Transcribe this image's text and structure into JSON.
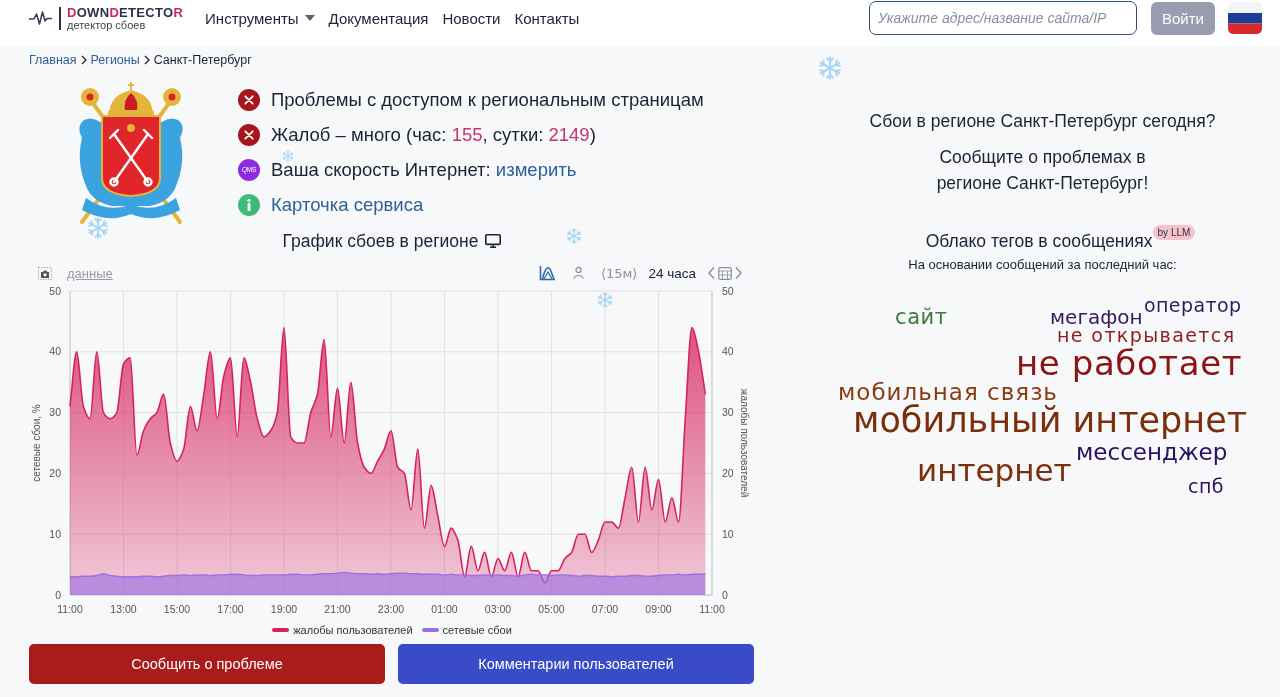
{
  "header": {
    "logo": {
      "segments": [
        {
          "text": "D",
          "accent": true
        },
        {
          "text": "OWN",
          "accent": false
        },
        {
          "text": "D",
          "accent": true
        },
        {
          "text": "ETECTO",
          "accent": false
        },
        {
          "text": "R",
          "accent": true
        }
      ],
      "tagline": "детектор сбоев"
    },
    "nav": [
      {
        "label": "Инструменты",
        "dropdown": true
      },
      {
        "label": "Документация",
        "dropdown": false
      },
      {
        "label": "Новости",
        "dropdown": false
      },
      {
        "label": "Контакты",
        "dropdown": false
      }
    ],
    "search": {
      "placeholder": "Укажите адрес/название сайта/IP"
    },
    "login_button": "Войти"
  },
  "breadcrumbs": [
    {
      "label": "Главная",
      "current": false
    },
    {
      "label": "Регионы",
      "current": false
    },
    {
      "label": "Санкт-Петербург",
      "current": true
    }
  ],
  "status": [
    {
      "kind": "error",
      "parts": [
        {
          "kind": "text",
          "text": "Проблемы с доступом к региональным страницам"
        }
      ]
    },
    {
      "kind": "error",
      "parts": [
        {
          "kind": "text",
          "text": "Жалоб – много (час: "
        },
        {
          "kind": "count",
          "text": "155"
        },
        {
          "kind": "text",
          "text": ", сутки: "
        },
        {
          "kind": "count",
          "text": "2149"
        },
        {
          "kind": "text",
          "text": ")"
        }
      ]
    },
    {
      "kind": "speed",
      "badge": "QMS",
      "parts": [
        {
          "kind": "text",
          "text": "Ваша скорость Интернет: "
        },
        {
          "kind": "link",
          "text": "измерить"
        }
      ]
    },
    {
      "kind": "info",
      "parts": [
        {
          "kind": "link",
          "text": "Карточка сервиса"
        }
      ]
    }
  ],
  "chart": {
    "data_link": "данные",
    "view_modes": [
      {
        "kind": "area",
        "selected": true
      },
      {
        "kind": "users",
        "selected": false
      }
    ],
    "periods": [
      {
        "label": "⟨15м⟩",
        "selected": false
      },
      {
        "label": "24 часа",
        "selected": true
      }
    ],
    "chart_data": {
      "type": "area",
      "title": "График сбоев в регионе",
      "ylabel": "сетевые сбои, %",
      "y2label": "жалобы пользователей",
      "grid": true,
      "legend": "bottom",
      "categories": [
        "11:00",
        null,
        null,
        null,
        null,
        null,
        null,
        null,
        "13:00",
        null,
        null,
        null,
        null,
        null,
        null,
        null,
        "15:00",
        null,
        null,
        null,
        null,
        null,
        null,
        null,
        "17:00",
        null,
        null,
        null,
        null,
        null,
        null,
        null,
        "19:00",
        null,
        null,
        null,
        null,
        null,
        null,
        null,
        "21:00",
        null,
        null,
        null,
        null,
        null,
        null,
        null,
        "23:00",
        null,
        null,
        null,
        null,
        null,
        null,
        null,
        "01:00",
        null,
        null,
        null,
        null,
        null,
        null,
        null,
        "03:00",
        null,
        null,
        null,
        null,
        null,
        null,
        null,
        "05:00",
        null,
        null,
        null,
        null,
        null,
        null,
        null,
        "07:00",
        null,
        null,
        null,
        null,
        null,
        null,
        null,
        "09:00",
        null,
        null,
        null,
        null,
        null,
        null,
        null,
        "11:00"
      ],
      "ylim": [
        0,
        50
      ],
      "yticks": [
        0,
        10,
        20,
        30,
        40,
        50
      ],
      "y2lim": [
        0,
        50
      ],
      "y2ticks": [
        0,
        10,
        20,
        30,
        40,
        50
      ],
      "series": [
        {
          "name": "жалобы пользователей",
          "color": "#d6225e",
          "values": [
            31,
            40,
            31,
            29,
            40,
            30,
            29,
            30,
            38,
            39,
            23,
            27,
            29,
            30,
            33,
            25,
            22,
            24,
            31,
            27,
            33,
            40,
            29,
            36,
            39,
            26,
            39,
            35,
            29,
            26,
            27,
            30,
            44,
            26,
            25,
            25,
            30,
            33,
            42,
            26,
            34,
            25,
            35,
            25,
            21,
            20,
            22,
            24,
            27,
            21,
            20,
            14,
            24,
            11,
            18,
            13,
            8,
            11,
            9,
            3,
            8,
            4,
            7,
            3,
            6,
            4,
            7,
            3,
            7,
            4,
            4,
            2,
            4,
            4,
            6,
            7,
            10,
            10,
            7,
            9,
            12,
            12,
            11,
            16,
            21,
            12,
            21,
            14,
            19,
            12,
            16,
            12,
            29,
            44,
            40,
            33,
            null
          ]
        },
        {
          "name": "сетевые сбои",
          "color": "#9e6fe0",
          "values": [
            3.0,
            3.0,
            3.1,
            3.1,
            3.2,
            3.5,
            3.2,
            3.1,
            3.0,
            3.0,
            3.0,
            3.1,
            3.1,
            3.0,
            3.1,
            3.2,
            3.2,
            3.3,
            3.2,
            3.3,
            3.3,
            3.2,
            3.3,
            3.3,
            3.4,
            3.4,
            3.3,
            3.2,
            3.2,
            3.3,
            3.3,
            3.3,
            3.3,
            3.4,
            3.4,
            3.3,
            3.3,
            3.4,
            3.5,
            3.5,
            3.6,
            3.7,
            3.6,
            3.5,
            3.5,
            3.4,
            3.5,
            3.4,
            3.5,
            3.6,
            3.6,
            3.5,
            3.5,
            3.4,
            3.4,
            3.4,
            3.3,
            3.4,
            3.3,
            3.3,
            3.2,
            3.2,
            3.3,
            3.2,
            3.3,
            3.2,
            3.2,
            3.1,
            3.3,
            3.4,
            3.3,
            3.3,
            3.2,
            3.3,
            3.3,
            3.2,
            3.1,
            3.2,
            3.2,
            3.1,
            3.1,
            3.0,
            3.1,
            3.1,
            3.2,
            3.2,
            3.1,
            3.1,
            3.2,
            3.3,
            3.3,
            3.4,
            3.3,
            3.4,
            3.4,
            3.5,
            null
          ]
        }
      ]
    }
  },
  "actions": [
    {
      "label": "Сообщить о проблеме",
      "kind": "danger"
    },
    {
      "label": "Комментарии пользователей",
      "kind": "primary"
    }
  ],
  "right_panel": {
    "question": "Сбои в регионе Санкт-Петербург сегодня?",
    "call_lines": [
      "Сообщите о проблемах в",
      "регионе Санкт-Петербург!"
    ],
    "cloud": {
      "title": "Облако тегов в сообщениях",
      "badge": "by LLM",
      "subtitle": "На основании сообщений за последний час:",
      "words": [
        {
          "text": "сайт",
          "color": "#3d7b3d"
        },
        {
          "text": "мегафон",
          "color": "#35195f"
        },
        {
          "text": "оператор",
          "color": "#35195f"
        },
        {
          "text": "не открывается",
          "color": "#8f1d1d"
        },
        {
          "text": "не работает",
          "color": "#8b1515"
        },
        {
          "text": "мобильная связь",
          "color": "#8a3b12"
        },
        {
          "text": "мобильный интернет",
          "color": "#7b2f0d"
        },
        {
          "text": "мессенджер",
          "color": "#2b0f63"
        },
        {
          "text": "интернет",
          "color": "#7b2f0d"
        },
        {
          "text": "спб",
          "color": "#2b0f63"
        }
      ]
    }
  }
}
